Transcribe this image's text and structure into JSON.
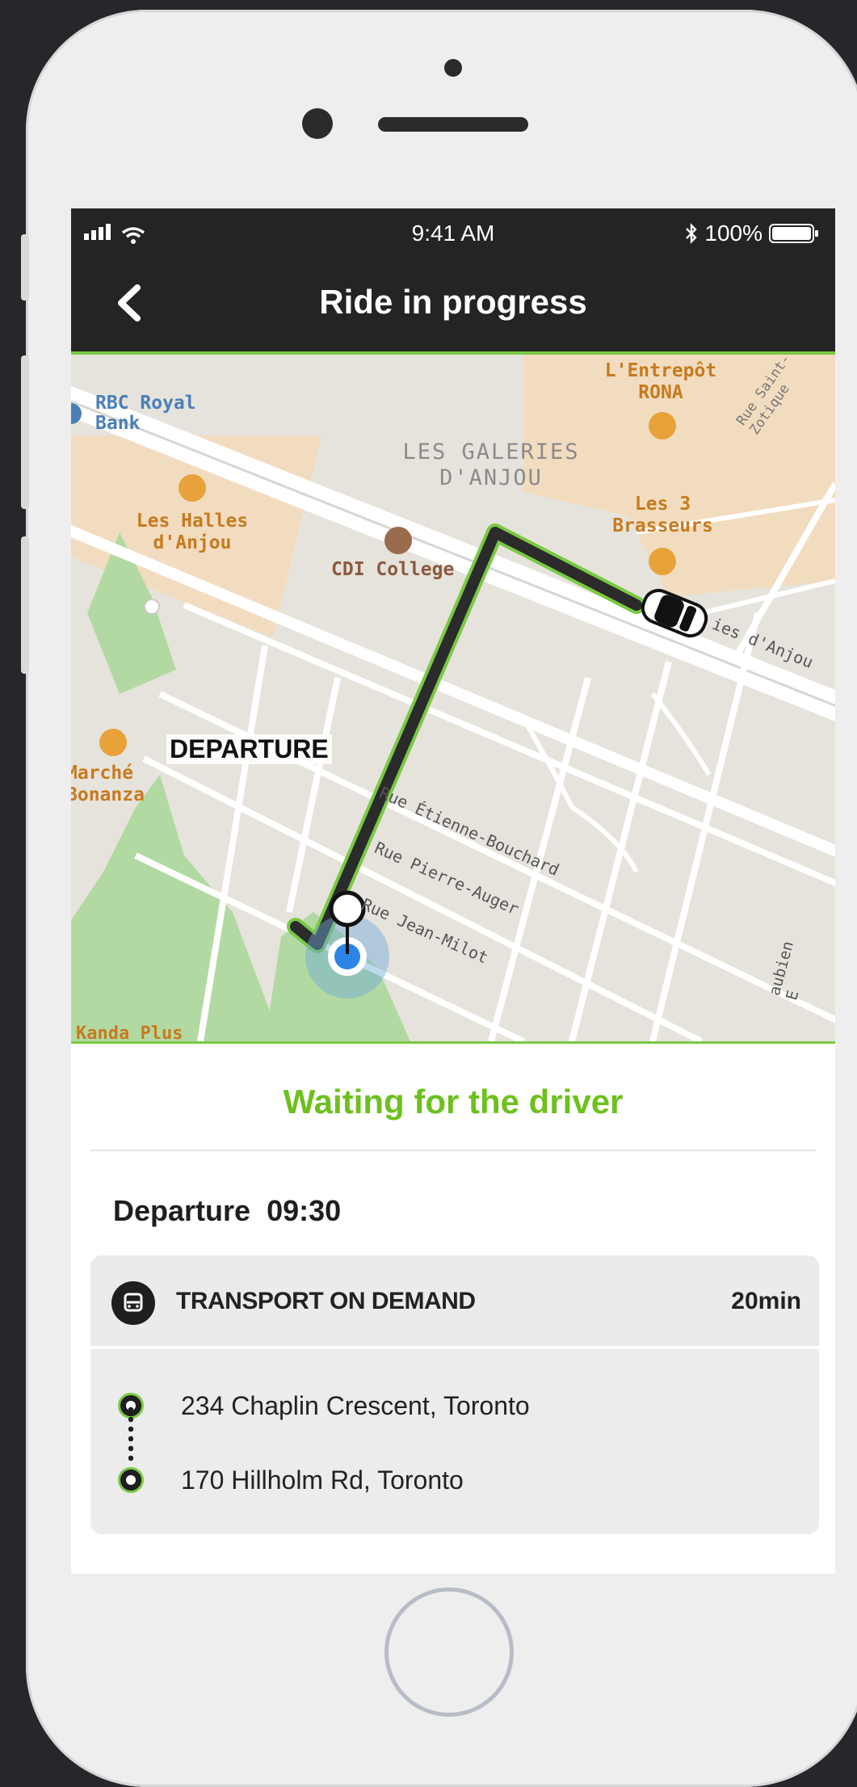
{
  "status_bar": {
    "time": "9:41 AM",
    "battery": "100%"
  },
  "nav": {
    "title": "Ride in progress"
  },
  "map": {
    "labels": {
      "bank": "RBC Royal Bank",
      "bank_l1": "RBC Royal",
      "bank_l2": "Bank",
      "galeries_l1": "LES GALERIES",
      "galeries_l2": "D'ANJOU",
      "entrepot_l1": "L'Entrepôt",
      "entrepot_l2": "RONA",
      "halles_l1": "Les Halles",
      "halles_l2": "d'Anjou",
      "college": "CDI College",
      "brasseurs_l1": "Les 3",
      "brasseurs_l2": "Brasseurs",
      "road_anjou": "ies d'Anjou",
      "departure": "DEPARTURE",
      "marche_l1": "Marché",
      "marche_l2": "Bonanza",
      "street1": "Rue Étienne-Bouchard",
      "street2": "Rue Pierre-Auger",
      "street3": "Rue Jean-Milot",
      "street4": "Rue Saint-Zotique",
      "street5": "aubien E",
      "kanda": "Kanda Plus"
    }
  },
  "panel": {
    "status": "Waiting for the driver",
    "departure_label": "Departure",
    "departure_time": "09:30",
    "mode": "TRANSPORT ON DEMAND",
    "duration": "20min",
    "stops": [
      "234 Chaplin Crescent, Toronto",
      "170 Hillholm Rd, Toronto"
    ]
  },
  "colors": {
    "accent": "#6cc11d",
    "dark": "#242424"
  }
}
